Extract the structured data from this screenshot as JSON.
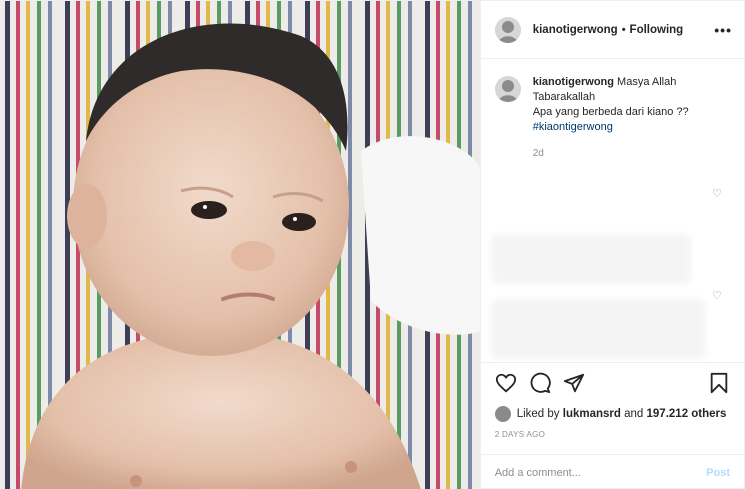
{
  "header": {
    "username": "kianotigerwong",
    "separator": "•",
    "follow_status": "Following",
    "more_label": "•••"
  },
  "caption": {
    "username": "kianotigerwong",
    "line1": "Masya Allah",
    "line2": "Tabarakallah",
    "line3": "Apa yang berbeda dari kiano ??",
    "hashtag": "#kiaontigerwong",
    "age": "2d"
  },
  "likes": {
    "prefix": "Liked by",
    "liker": "lukmansrd",
    "connector": "and",
    "count": "197.212 others"
  },
  "post_date": "2 DAYS AGO",
  "comment_box": {
    "placeholder": "Add a comment...",
    "post_label": "Post"
  },
  "icons": {
    "like": "heart-icon",
    "comment": "comment-icon",
    "share": "share-icon",
    "save": "bookmark-icon",
    "comment_like": "heart-icon"
  },
  "colors": {
    "hashtag": "#00376b",
    "muted": "#8e8e8e",
    "post_button": "#b3dbff",
    "border": "#efefef"
  }
}
